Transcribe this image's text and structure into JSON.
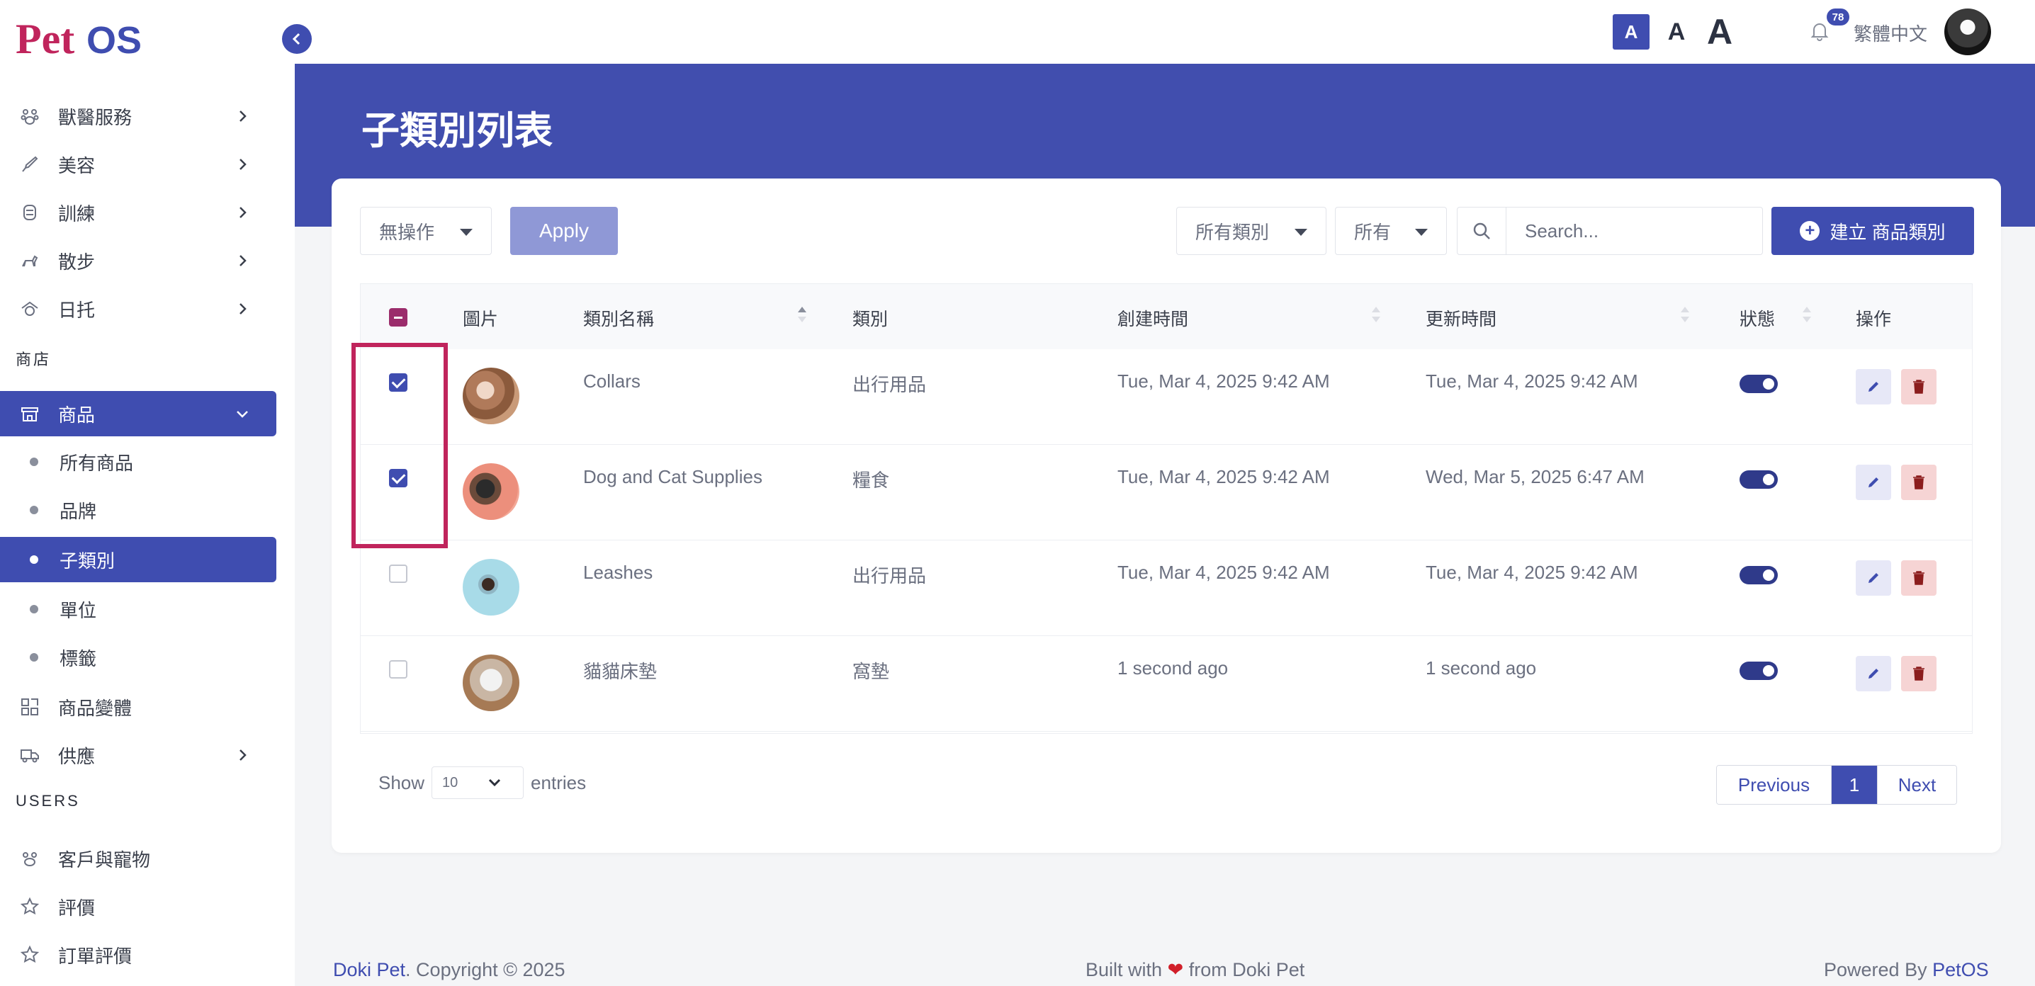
{
  "brand": {
    "logo_text": "PetOS",
    "accent": "#3f4db0",
    "band": "#414eae"
  },
  "sidebar": {
    "items": [
      {
        "label": "獸醫服務",
        "icon": "paw-group-icon",
        "has_children": true
      },
      {
        "label": "美容",
        "icon": "brush-icon",
        "has_children": true
      },
      {
        "label": "訓練",
        "icon": "whistle-icon",
        "has_children": true
      },
      {
        "label": "散步",
        "icon": "dog-walk-icon",
        "has_children": true
      },
      {
        "label": "日托",
        "icon": "daycare-icon",
        "has_children": true
      }
    ],
    "section_shop": "商店",
    "products": {
      "label": "商品",
      "icon": "store-icon",
      "expanded": true
    },
    "sub_items": [
      {
        "label": "所有商品",
        "active": false
      },
      {
        "label": "品牌",
        "active": false
      },
      {
        "label": "子類別",
        "active": true
      },
      {
        "label": "單位",
        "active": false
      },
      {
        "label": "標籤",
        "active": false
      }
    ],
    "variants": {
      "label": "商品變體",
      "icon": "variants-icon"
    },
    "supply": {
      "label": "供應",
      "icon": "truck-icon"
    },
    "section_users": "USERS",
    "users_items": [
      {
        "label": "客戶與寵物",
        "icon": "paw-icon"
      },
      {
        "label": "評價",
        "icon": "star-icon"
      },
      {
        "label": "訂單評價",
        "icon": "star-icon"
      }
    ]
  },
  "topbar": {
    "font_small": "A",
    "font_medium": "A",
    "font_large": "A",
    "notification_count": "78",
    "language": "繁體中文"
  },
  "page": {
    "title": "子類別列表"
  },
  "toolbar": {
    "bulk_action": "無操作",
    "apply_label": "Apply",
    "category_filter": "所有類別",
    "status_filter": "所有",
    "search_placeholder": "Search...",
    "create_label": "建立 商品類別"
  },
  "table": {
    "columns": [
      "圖片",
      "類別名稱",
      "類別",
      "創建時間",
      "更新時間",
      "狀態",
      "操作"
    ],
    "rows": [
      {
        "checked": true,
        "name": "Collars",
        "category": "出行用品",
        "created": "Tue, Mar 4, 2025 9:42 AM",
        "updated": "Tue, Mar 4, 2025 9:42 AM",
        "status_on": true
      },
      {
        "checked": true,
        "name": "Dog and Cat Supplies",
        "category": "糧食",
        "created": "Tue, Mar 4, 2025 9:42 AM",
        "updated": "Wed, Mar 5, 2025 6:47 AM",
        "status_on": true
      },
      {
        "checked": false,
        "name": "Leashes",
        "category": "出行用品",
        "created": "Tue, Mar 4, 2025 9:42 AM",
        "updated": "Tue, Mar 4, 2025 9:42 AM",
        "status_on": true
      },
      {
        "checked": false,
        "name": "貓貓床墊",
        "category": "窩墊",
        "created": "1 second ago",
        "updated": "1 second ago",
        "status_on": true
      }
    ]
  },
  "pagination": {
    "show_label": "Show",
    "page_size": "10",
    "entries_label": "entries",
    "previous": "Previous",
    "current": "1",
    "next": "Next"
  },
  "footer": {
    "left_brand": "Doki Pet",
    "left_rest": ". Copyright © 2025",
    "center_prefix": "Built with",
    "center_suffix": "from Doki Pet",
    "right_prefix": "Powered By",
    "right_brand": "PetOS"
  }
}
